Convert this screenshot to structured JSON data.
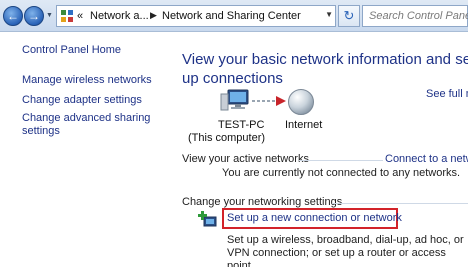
{
  "addressbar": {
    "crumbs": [
      "Network a...",
      "Network and Sharing Center"
    ],
    "search_placeholder": "Search Control Panel",
    "overflow": "«"
  },
  "leftpane": {
    "items": [
      {
        "label": "Control Panel Home"
      },
      {
        "label": "Manage wireless networks"
      },
      {
        "label": "Change adapter settings"
      },
      {
        "label": "Change advanced sharing settings"
      }
    ]
  },
  "main": {
    "heading": "View your basic network information and set up connections",
    "see_full_map": "See full m",
    "map": {
      "computer_name": "TEST-PC",
      "computer_sub": "(This computer)",
      "internet_label": "Internet"
    },
    "active_networks": {
      "label": "View your active networks",
      "connect_link": "Connect to a netw",
      "status": "You are currently not connected to any networks."
    },
    "change_settings": {
      "label": "Change your networking settings",
      "setup_link": "Set up a new connection or network",
      "setup_desc": "Set up a wireless, broadband, dial-up, ad hoc, or VPN connection; or set up a router or access point."
    }
  },
  "icons": [
    "back-arrow-icon",
    "forward-arrow-icon",
    "control-panel-icon",
    "refresh-icon",
    "computer-icon",
    "connection-arrow-icon",
    "globe-icon",
    "new-connection-icon"
  ],
  "colors": {
    "link": "#1e3287",
    "highlight_box": "#d2232a"
  }
}
